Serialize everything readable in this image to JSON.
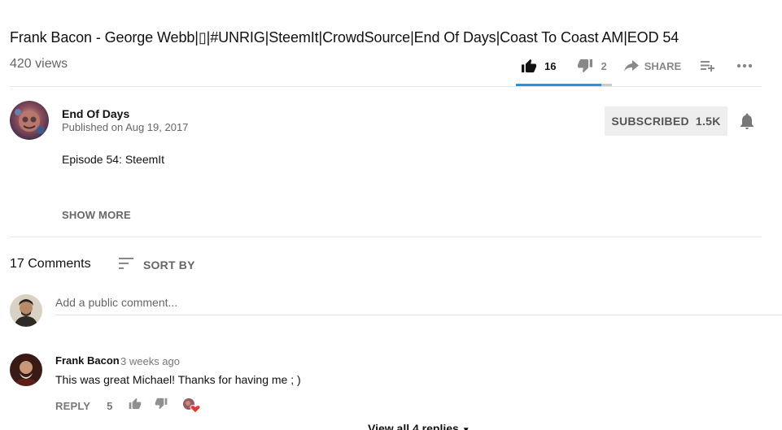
{
  "video": {
    "title": "Frank Bacon - George Webb|▯|#UNRIG|SteemIt|CrowdSource|End Of Days|Coast To Coast AM|EOD 54",
    "views": "420 views",
    "like_count": "16",
    "dislike_count": "2",
    "share_label": "SHARE",
    "like_ratio": 0.89
  },
  "channel": {
    "name": "End Of Days",
    "published": "Published on Aug 19, 2017",
    "subscribe_label": "SUBSCRIBED",
    "subscriber_count": "1.5K"
  },
  "description": {
    "text": "Episode 54: SteemIt",
    "show_more": "SHOW MORE"
  },
  "comments": {
    "count_label": "17 Comments",
    "sort_label": "SORT BY",
    "add_placeholder": "Add a public comment...",
    "items": [
      {
        "author": "Frank Bacon",
        "time": "3 weeks ago",
        "text": "This was great Michael!  Thanks for having me ; )",
        "reply_label": "REPLY",
        "likes": "5",
        "view_replies": "View all 4 replies"
      }
    ]
  },
  "colors": {
    "accent_blue": "#2793e6",
    "heart_red": "#e53935"
  }
}
